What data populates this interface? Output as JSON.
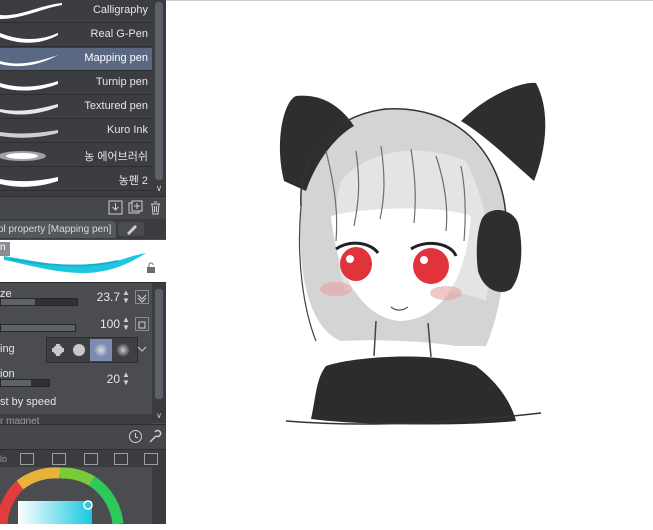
{
  "brush_list": {
    "items": [
      {
        "label": "Calligraphy",
        "selected": false
      },
      {
        "label": "Real G-Pen",
        "selected": false
      },
      {
        "label": "Mapping pen",
        "selected": true
      },
      {
        "label": "Turnip pen",
        "selected": false
      },
      {
        "label": "Textured pen",
        "selected": false
      },
      {
        "label": "Kuro Ink",
        "selected": false
      },
      {
        "label": "농 에어브러쉬",
        "selected": false
      },
      {
        "label": "농펜 2",
        "selected": false
      }
    ],
    "tools": [
      "download-icon",
      "duplicate-icon",
      "trash-icon"
    ]
  },
  "tool_property": {
    "header": "ol property [Mapping pen]",
    "preview_name": "n",
    "rows": [
      {
        "label": "ze",
        "value": "23.7",
        "level": 0.45
      },
      {
        "label": "",
        "value": "100",
        "level": 1.0
      },
      {
        "label": "ing",
        "options": [
          "hard-tip-icon",
          "soft-tip-icon",
          "blur-tip-icon",
          "airbrush-tip-icon"
        ],
        "selected_option": 2
      },
      {
        "label": "ion",
        "value": "20",
        "level": 0.6
      },
      {
        "label": "st by speed"
      },
      {
        "label": "r magnet"
      }
    ]
  },
  "bottom_tabs": [
    "lo",
    "settings-icon",
    "layers-icon",
    "pages-icon",
    "grid-icon"
  ],
  "colors": {
    "panel_bg": "#4a4c50",
    "list_bg": "#3b3d41",
    "selected_bg": "#5a6884",
    "accent_cyan": "#00c8e0"
  }
}
